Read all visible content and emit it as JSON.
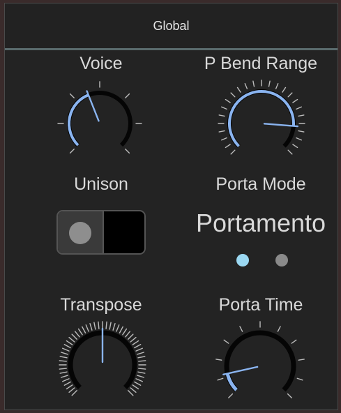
{
  "panel": {
    "title": "Global"
  },
  "controls": {
    "voice": {
      "label": "Voice",
      "value": 0.42
    },
    "pbend": {
      "label": "P Bend Range",
      "value": 0.85
    },
    "unison": {
      "label": "Unison",
      "on": false
    },
    "porta_mode": {
      "label": "Porta Mode",
      "value": "Portamento",
      "options_count": 2,
      "selected_index": 0
    },
    "transpose": {
      "label": "Transpose",
      "value": 0.5
    },
    "porta_time": {
      "label": "Porta Time",
      "value": 0.12
    }
  },
  "colors": {
    "accent": "#8ab4f0",
    "selected_dot": "#9bd8f2",
    "unselected_dot": "#8a8a8a",
    "arc_track": "#050505",
    "tick": "#bdbdbd"
  }
}
